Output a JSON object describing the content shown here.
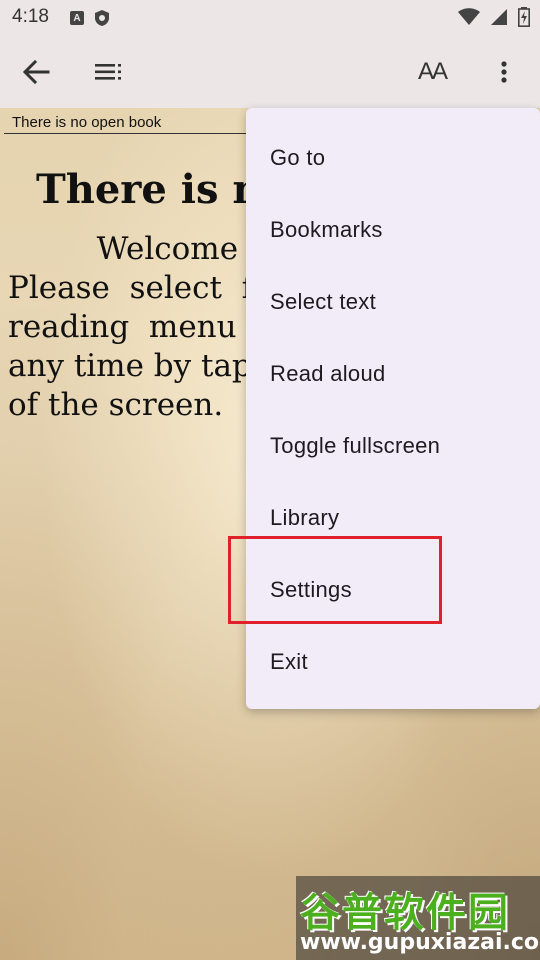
{
  "status_bar": {
    "time": "4:18",
    "left_icons": [
      "a-box-icon",
      "shield-icon"
    ],
    "right_icons": [
      "wifi-icon",
      "signal-icon",
      "battery-icon"
    ],
    "a_icon_letter": "A"
  },
  "toolbar": {
    "back_icon": "arrow-left-icon",
    "toc_icon": "list-icon",
    "font_size_icon": "font-size-icon",
    "overflow_icon": "more-vert-icon",
    "font_size_glyph": "AA"
  },
  "book": {
    "header": "There is no open book",
    "title": "There is n",
    "body_lines": [
      "         Welcome",
      "Please  select  f",
      "reading  menu",
      "any time by tap",
      "of the screen."
    ]
  },
  "menu": {
    "items": [
      {
        "label": "Go to"
      },
      {
        "label": "Bookmarks"
      },
      {
        "label": "Select text"
      },
      {
        "label": "Read aloud"
      },
      {
        "label": "Toggle fullscreen"
      },
      {
        "label": "Library"
      },
      {
        "label": "Settings"
      },
      {
        "label": "Exit"
      }
    ],
    "highlighted": "Settings"
  },
  "watermark": {
    "cn": "谷普软件园",
    "url": "www.gupuxiazai.com"
  },
  "colors": {
    "highlight": "#e0202a",
    "menu_bg": "#f1ecf7",
    "watermark_green": "#4caf1e"
  }
}
